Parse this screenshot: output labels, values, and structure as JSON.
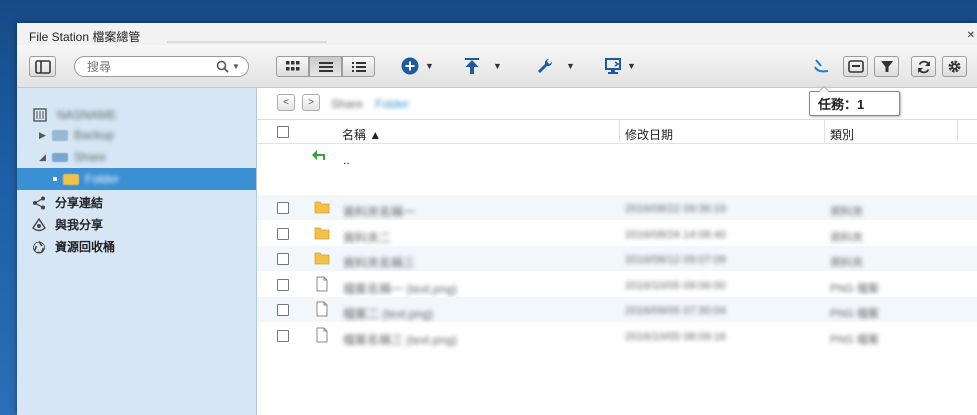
{
  "window": {
    "title": "File Station 檔案總管"
  },
  "toolbar": {
    "search": {
      "placeholder": "搜尋",
      "value": ""
    }
  },
  "sidebar": {
    "tree": [
      {
        "label": "NASNAME",
        "icon": "nas-server-icon",
        "blurred": true
      },
      {
        "label": "Backup",
        "icon": "drive-icon",
        "blurred": true
      },
      {
        "label": "Share",
        "icon": "network-drive-icon",
        "blurred": true
      },
      {
        "label": "Folder",
        "icon": "folder-icon",
        "blurred": true,
        "selected": true
      }
    ],
    "links": [
      {
        "label": "分享連結",
        "icon": "share-link-icon"
      },
      {
        "label": "與我分享",
        "icon": "shared-with-me-icon"
      },
      {
        "label": "資源回收桶",
        "icon": "recycle-bin-icon"
      }
    ]
  },
  "main": {
    "path": {
      "nav_back": "<",
      "nav_forward": ">",
      "segments": [
        "Share",
        "Folder"
      ]
    },
    "columns": {
      "name": "名稱 ▲",
      "modified": "修改日期",
      "type": "類別"
    },
    "parent_row": {
      "label": ".."
    },
    "files": [
      {
        "kind": "folder",
        "name": "資料夾名稱一",
        "date": "2016/08/22 09:36:19",
        "type": "資料夾"
      },
      {
        "kind": "folder",
        "name": "資料夾二",
        "date": "2016/08/24 14:08:40",
        "type": "資料夾"
      },
      {
        "kind": "folder",
        "name": "資料夾名稱三",
        "date": "2016/08/12 09:07:09",
        "type": "資料夾"
      },
      {
        "kind": "file",
        "name": "檔案名稱一 (text.png)",
        "date": "2016/10/05 09:06:00",
        "type": "PNG 檔案"
      },
      {
        "kind": "file",
        "name": "檔案二 (text.png)",
        "date": "2016/09/05 07:30:04",
        "type": "PNG 檔案"
      },
      {
        "kind": "file",
        "name": "檔案名稱三 (text.png)",
        "date": "2016/10/05 08:09:16",
        "type": "PNG 檔案"
      }
    ]
  },
  "tooltip": {
    "text": "任務：1"
  },
  "colors": {
    "accent": "#3b8fd3",
    "sidebar": "#d6e6f4",
    "folder": "#f2c14a",
    "add": "#1d5aa0"
  }
}
